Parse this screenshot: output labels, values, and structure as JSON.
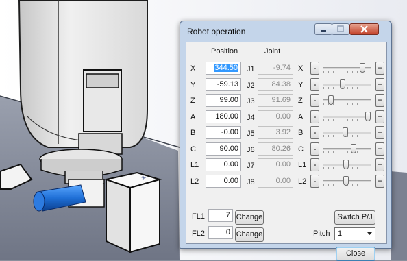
{
  "window": {
    "title": "Robot operation"
  },
  "headers": {
    "position": "Position",
    "joint": "Joint"
  },
  "axes": [
    {
      "label": "X",
      "position": "344.50",
      "joint_label": "J1",
      "joint": "-9.74",
      "slider_label": "X",
      "slider": 0.82
    },
    {
      "label": "Y",
      "position": "-59.13",
      "joint_label": "J2",
      "joint": "84.38",
      "slider_label": "Y",
      "slider": 0.4
    },
    {
      "label": "Z",
      "position": "99.00",
      "joint_label": "J3",
      "joint": "91.69",
      "slider_label": "Z",
      "slider": 0.15
    },
    {
      "label": "A",
      "position": "180.00",
      "joint_label": "J4",
      "joint": "0.00",
      "slider_label": "A",
      "slider": 0.93
    },
    {
      "label": "B",
      "position": "-0.00",
      "joint_label": "J5",
      "joint": "3.92",
      "slider_label": "B",
      "slider": 0.45
    },
    {
      "label": "C",
      "position": "90.00",
      "joint_label": "J6",
      "joint": "80.26",
      "slider_label": "C",
      "slider": 0.63
    },
    {
      "label": "L1",
      "position": "0.00",
      "joint_label": "J7",
      "joint": "0.00",
      "slider_label": "L1",
      "slider": 0.47
    },
    {
      "label": "L2",
      "position": "0.00",
      "joint_label": "J8",
      "joint": "0.00",
      "slider_label": "L2",
      "slider": 0.47
    }
  ],
  "minus": "-",
  "plus": "+",
  "fl1": {
    "label": "FL1",
    "value": "7",
    "button": "Change"
  },
  "fl2": {
    "label": "FL2",
    "value": "0",
    "button": "Change"
  },
  "switch_button": "Switch P/J",
  "pitch": {
    "label": "Pitch",
    "value": "1"
  },
  "close_button": "Close",
  "colors": {
    "titlebar": "#c4d5ea",
    "selection": "#3399ff",
    "close_caption": "#c4432b",
    "tool": "#1f6fd6"
  }
}
